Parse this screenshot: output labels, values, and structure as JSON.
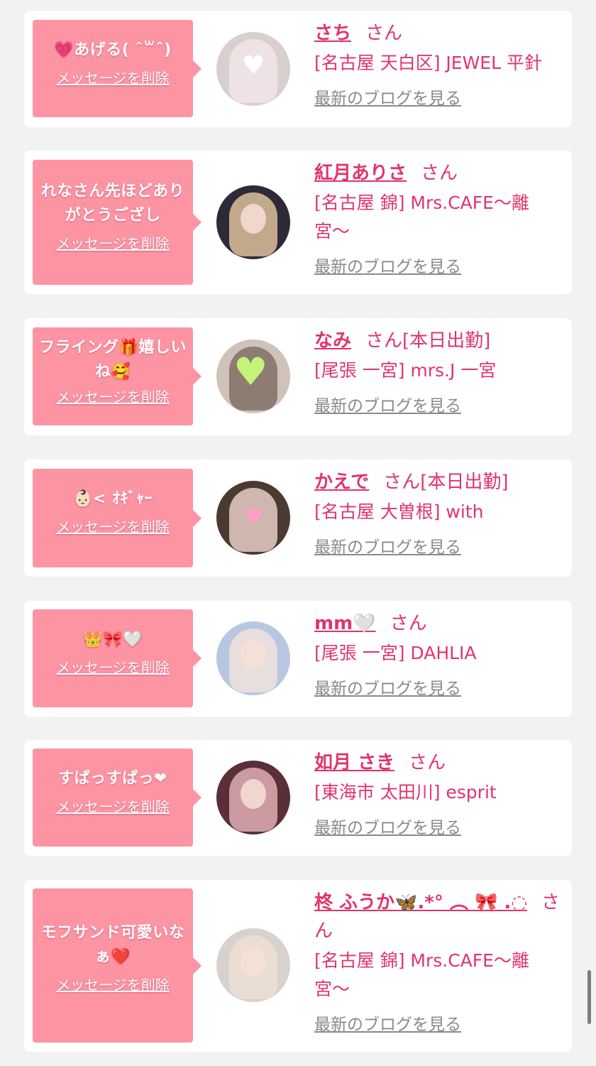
{
  "common": {
    "delete_label": "メッセージを削除",
    "blog_label": "最新のブログを見る",
    "honorific": "さん"
  },
  "items": [
    {
      "message": "💗あげる( ˆ꒳ˆ)",
      "name": "さち",
      "status": "",
      "shop": "[名古屋 天白区] JEWEL 平針",
      "avatar_icon": "heart-sticker-portrait",
      "avatar_bg": "#d9cfcf",
      "avatar_accent": "#f3e6ea"
    },
    {
      "message": "れなさん先ほどありがとうござし",
      "name": "紅月ありさ",
      "status": "",
      "shop": "[名古屋 錦] Mrs.CAFE〜離宮〜",
      "avatar_icon": "portrait",
      "avatar_bg": "#2e2a3a",
      "avatar_accent": "#e8c9a0"
    },
    {
      "message": "フライング🎁嬉しいね🥰",
      "name": "なみ",
      "status": "[本日出勤]",
      "shop": "[尾張 一宮] mrs.J 一宮",
      "avatar_icon": "green-heart-sticker-portrait",
      "avatar_bg": "#cfc2b8",
      "avatar_accent": "#7b6a60"
    },
    {
      "message": "👶🏻< ｵｷﾞｬｰ",
      "name": "かえで",
      "status": "[本日出勤]",
      "shop": "[名古屋 大曽根] with",
      "avatar_icon": "pink-heart-sticker-portrait",
      "avatar_bg": "#4a3a32",
      "avatar_accent": "#f0d7cf"
    },
    {
      "message": "👑🎀🤍",
      "name": "mm🤍",
      "status": "",
      "shop": "[尾張 一宮] DAHLIA",
      "avatar_icon": "portrait",
      "avatar_bg": "#b8c7e0",
      "avatar_accent": "#f2e3dc"
    },
    {
      "message": "すぱっすぱっ❤",
      "name": "如月 さき",
      "status": "",
      "shop": "[東海市 太田川] esprit",
      "avatar_icon": "portrait",
      "avatar_bg": "#5a2f38",
      "avatar_accent": "#e8b6bc"
    },
    {
      "message": "モフサンド可愛いなぁ❤️",
      "name": "柊 ふうか🦋.*° ︵ 🎀 .◌",
      "status": "",
      "shop": "[名古屋 錦] Mrs.CAFE〜離宮〜",
      "avatar_icon": "portrait",
      "avatar_bg": "#d8d2ce",
      "avatar_accent": "#efe0d6"
    }
  ]
}
